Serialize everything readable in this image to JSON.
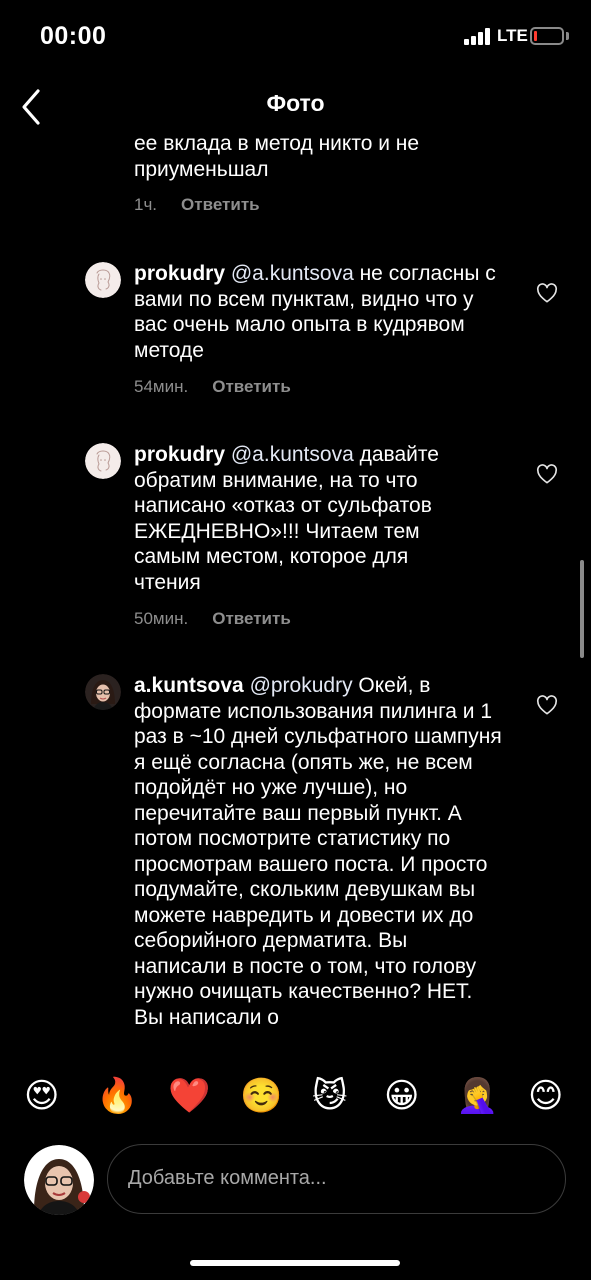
{
  "status_bar": {
    "time": "00:00",
    "network": "LTE",
    "battery_color": "#ff3b30"
  },
  "header": {
    "title": "Фото",
    "back_icon": "chevron-left-icon"
  },
  "comments": [
    {
      "text": "ее вклада в метод никто и не приуменьшал",
      "time": "1ч.",
      "reply_label": "Ответить"
    },
    {
      "username": "prokudry",
      "mention": "@a.kuntsova",
      "text": " не согласны с вами по всем пунктам, видно что у вас очень мало опыта в кудрявом методе",
      "time": "54мин.",
      "reply_label": "Ответить"
    },
    {
      "username": "prokudry",
      "mention": "@a.kuntsova",
      "text": " давайте обратим внимание, на то что написано «отказ от сульфатов ЕЖЕДНЕВНО»!!! Читаем тем самым местом, которое для чтения",
      "time": "50мин.",
      "reply_label": "Ответить"
    },
    {
      "username": "a.kuntsova",
      "mention": "@prokudry",
      "text": " Окей, в формате использования пилинга и 1 раз в ~10 дней сульфатного шампуня я ещё согласна (опять же, не всем подойдёт но уже лучше), но перечитайте ваш первый пункт. А потом посмотрите статистику по просмотрам вашего поста. И просто подумайте, скольким девушкам вы можете навредить и довести их до себорийного дерматита.  Вы написали в посте о том, что голову нужно очищать качественно? НЕТ. Вы написали о"
    }
  ],
  "emoji_bar": [
    "😍",
    "🔥",
    "❤️",
    "☺️",
    "😼",
    "😀",
    "🤦‍♀️",
    "😊"
  ],
  "composer": {
    "placeholder": "Добавьте коммента..."
  }
}
